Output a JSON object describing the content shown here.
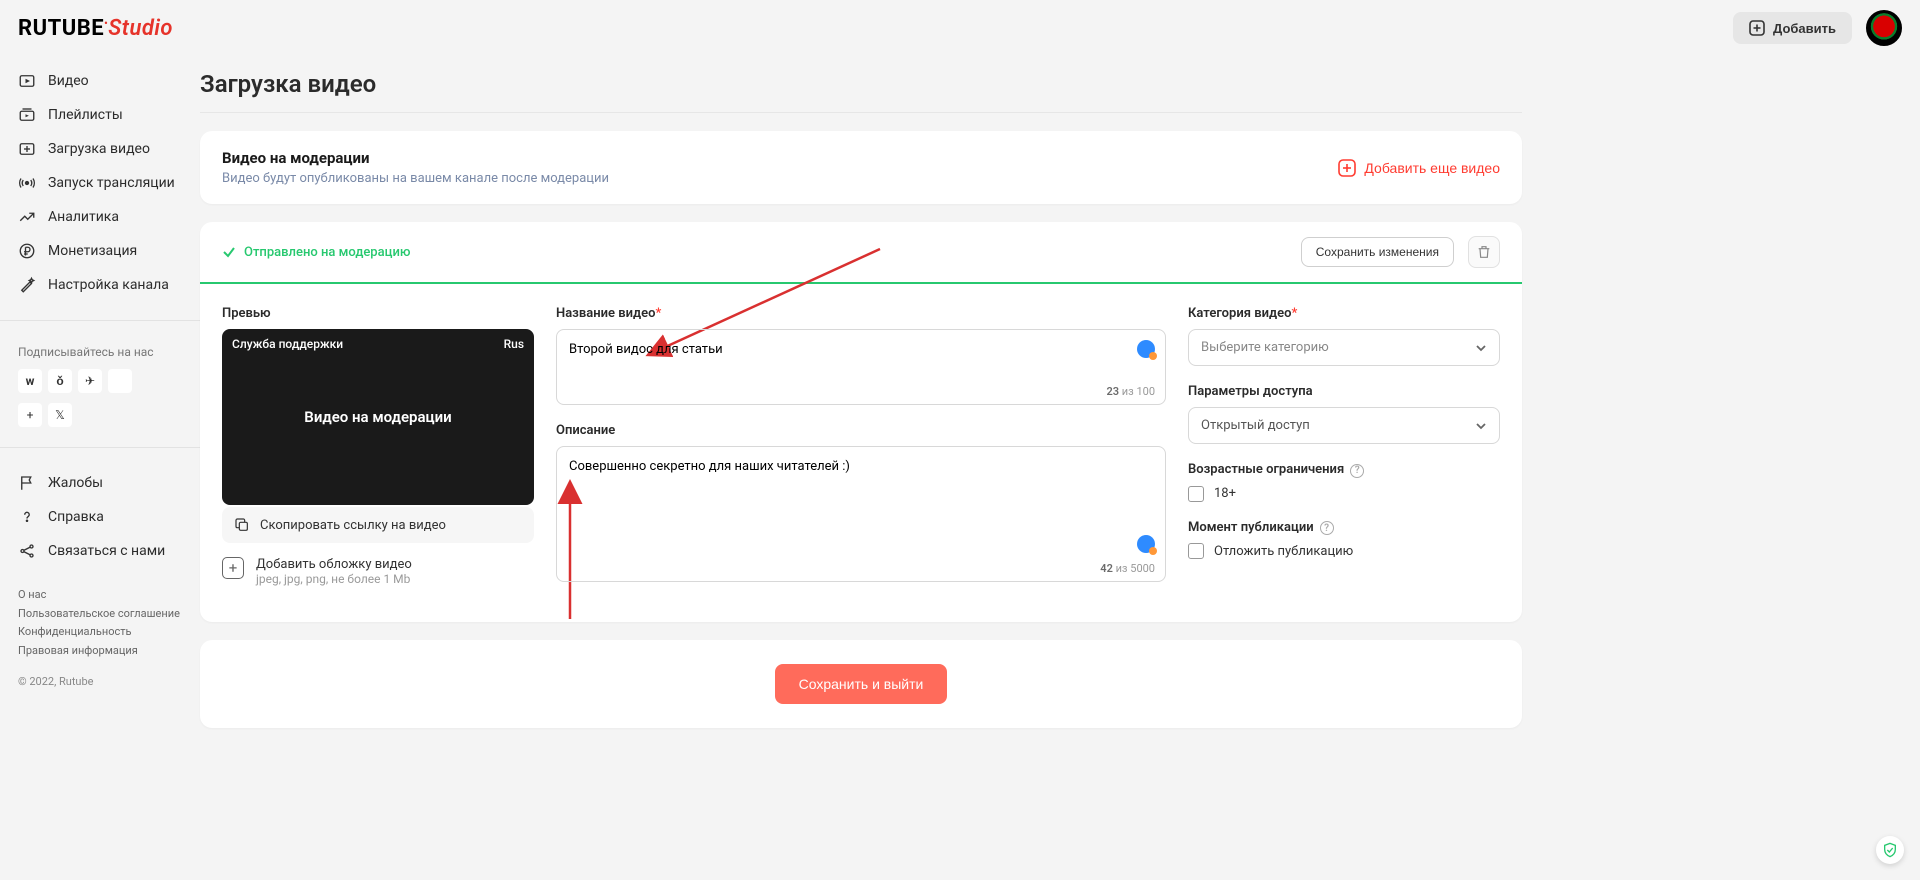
{
  "header": {
    "logo_black": "RUTUBE",
    "logo_red": "Studio",
    "add_button": "Добавить"
  },
  "sidebar": {
    "nav": [
      "Видео",
      "Плейлисты",
      "Загрузка видео",
      "Запуск трансляции",
      "Аналитика",
      "Монетизация",
      "Настройка канала"
    ],
    "subscribe": "Подписывайтесь на нас",
    "help_nav": [
      "Жалобы",
      "Справка",
      "Связаться с нами"
    ],
    "footer": [
      "О нас",
      "Пользовательское соглашение",
      "Конфиденциальность",
      "Правовая информация"
    ],
    "copyright": "© 2022, Rutube"
  },
  "page": {
    "title": "Загрузка видео"
  },
  "moderation_banner": {
    "title": "Видео на модерации",
    "subtitle": "Видео будут опубликованы на вашем канале после модерации",
    "add_more": "Добавить еще видео"
  },
  "form": {
    "status": "Отправлено на модерацию",
    "save_changes": "Сохранить изменения",
    "preview": {
      "label": "Превью",
      "top_left": "Служба поддержки",
      "top_right": "Rus",
      "center": "Видео на модерации",
      "copy_link": "Скопировать ссылку на видео",
      "add_cover": "Добавить обложку видео",
      "add_cover_hint": "jpeg, jpg, png, не более 1 Mb"
    },
    "title_field": {
      "label": "Название видео",
      "value": "Второй видос для статьи",
      "count_cur": "23",
      "count_sep": " из ",
      "count_max": "100"
    },
    "desc_field": {
      "label": "Описание",
      "value": "Совершенно секретно для наших читателей :)",
      "count_cur": "42",
      "count_sep": " из ",
      "count_max": "5000"
    },
    "category": {
      "label": "Категория видео",
      "placeholder": "Выберите категорию"
    },
    "access": {
      "label": "Параметры доступа",
      "value": "Открытый доступ"
    },
    "age": {
      "label": "Возрастные ограничения",
      "option": "18+"
    },
    "publish": {
      "label": "Момент публикации",
      "option": "Отложить публикацию"
    },
    "save_exit": "Сохранить и выйти"
  }
}
